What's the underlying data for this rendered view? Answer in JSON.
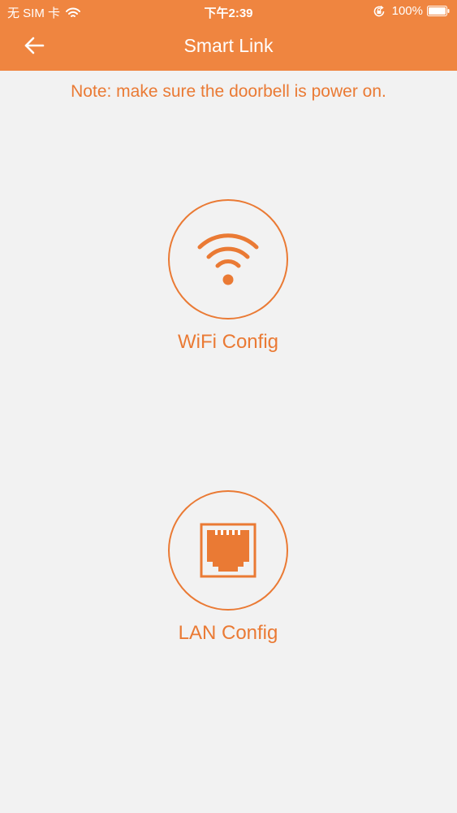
{
  "status_bar": {
    "carrier": "无 SIM 卡",
    "time": "下午2:39",
    "battery": "100%"
  },
  "nav": {
    "title": "Smart Link"
  },
  "note": "Note: make sure the doorbell is power on.",
  "options": [
    {
      "label": "WiFi Config",
      "icon": "wifi-icon"
    },
    {
      "label": "LAN Config",
      "icon": "ethernet-port-icon"
    }
  ],
  "colors": {
    "header": "#ef8540",
    "accent": "#ea7a34",
    "background": "#f2f2f2"
  }
}
